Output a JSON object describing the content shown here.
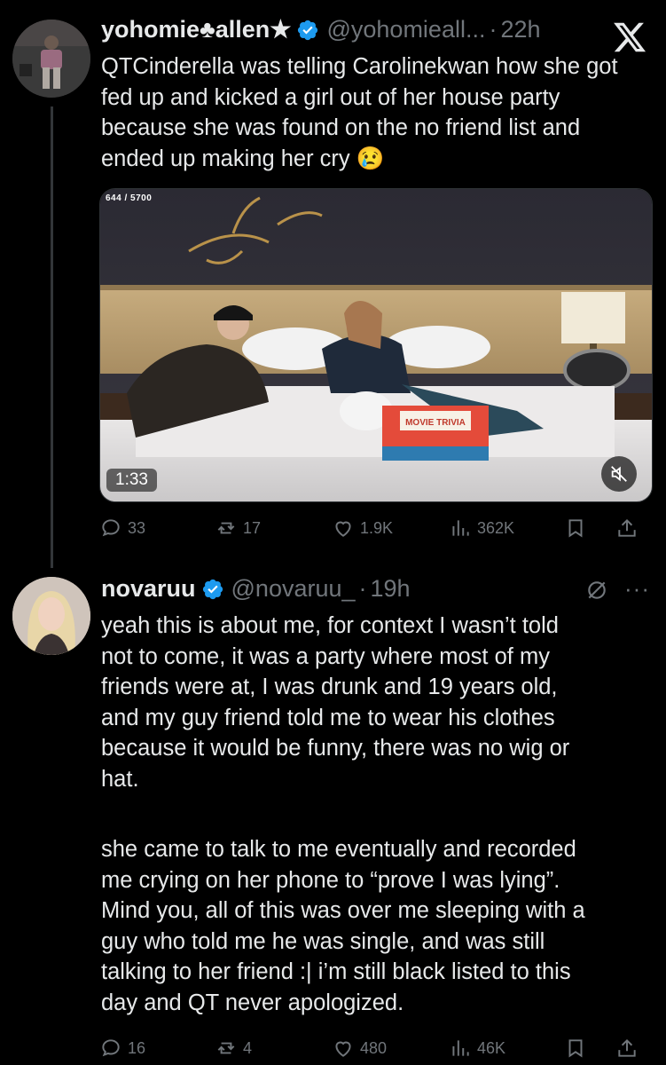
{
  "tweet1": {
    "display_name": "yohomie♣allen★",
    "handle": "@yohomieall...",
    "separator": "·",
    "time": "22h",
    "text": "QTCinderella was telling Carolinekwan how she got fed up and kicked a girl out of her house party because she was found on the no friend list and ended up making her cry",
    "emoji": "😢",
    "media": {
      "counter": "644 / 5700",
      "duration": "1:33",
      "box_text": "MOVIE TRIVIA"
    },
    "metrics": {
      "replies": "33",
      "reposts": "17",
      "likes": "1.9K",
      "views": "362K"
    }
  },
  "tweet2": {
    "display_name": "novaruu",
    "handle": "@novaruu_",
    "separator": "·",
    "time": "19h",
    "paragraph1": "yeah this is about me, for context I wasn’t told\nnot to come, it was a party where most of my\nfriends were at, I was drunk and 19 years old,\nand my guy friend told me to wear his clothes\nbecause it would be funny, there was no wig or\nhat.",
    "paragraph2": "she came to talk to me eventually and recorded\nme crying on her phone to “prove I was lying”.\nMind you, all of this was over me sleeping with a\nguy who told me he was single, and was still\ntalking to her friend :| i’m still black listed to this\nday and QT never apologized.",
    "metrics": {
      "replies": "16",
      "reposts": "4",
      "likes": "480",
      "views": "46K"
    }
  },
  "colors": {
    "background": "#000000",
    "text": "#e7e9ea",
    "secondary": "#71767b",
    "verified": "#1d9bf0",
    "thread_line": "#333639"
  },
  "icons": [
    "x-logo-icon",
    "verified-icon",
    "reply-icon",
    "repost-icon",
    "like-icon",
    "views-icon",
    "bookmark-icon",
    "share-icon",
    "mute-icon",
    "grok-icon",
    "more-icon"
  ]
}
